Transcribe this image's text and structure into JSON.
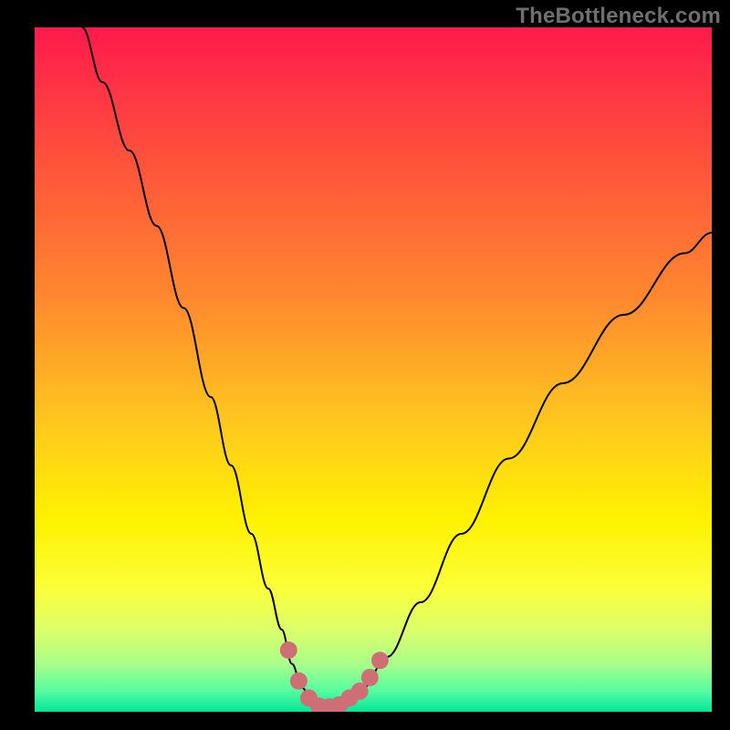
{
  "watermark": "TheBottleneck.com",
  "colors": {
    "frame": "#000000",
    "watermark_text": "#6f6f6f",
    "curve": "#000000",
    "markers": "#cf6e74",
    "gradient_stops": [
      {
        "offset": 0.0,
        "color": "#ff1a4c"
      },
      {
        "offset": 0.18,
        "color": "#ff4e3d"
      },
      {
        "offset": 0.4,
        "color": "#ff8a2e"
      },
      {
        "offset": 0.58,
        "color": "#ffc81e"
      },
      {
        "offset": 0.72,
        "color": "#fff200"
      },
      {
        "offset": 0.82,
        "color": "#fbff3a"
      },
      {
        "offset": 0.88,
        "color": "#dcff6a"
      },
      {
        "offset": 0.93,
        "color": "#a9ff8a"
      },
      {
        "offset": 0.97,
        "color": "#55fca0"
      },
      {
        "offset": 1.0,
        "color": "#00e89a"
      }
    ]
  },
  "chart_data": {
    "type": "line",
    "title": "",
    "xlabel": "",
    "ylabel": "",
    "xlim": [
      0,
      100
    ],
    "ylim": [
      0,
      100
    ],
    "series": [
      {
        "name": "bottleneck-curve",
        "x": [
          7,
          10,
          14,
          18,
          22,
          26,
          29,
          32,
          34.5,
          36.5,
          38,
          39.5,
          41,
          42.5,
          44,
          46,
          48.5,
          52,
          57,
          63,
          70,
          78,
          87,
          96,
          100
        ],
        "y": [
          100,
          92,
          82,
          71,
          59,
          46,
          36,
          26,
          18,
          12,
          7,
          3.5,
          1.5,
          0.6,
          0.6,
          1.4,
          3.5,
          8,
          16,
          26,
          37,
          48,
          58,
          67,
          70
        ]
      }
    ],
    "markers": {
      "name": "highlight-points",
      "x": [
        37.5,
        39.0,
        40.5,
        42.0,
        43.5,
        45.0,
        46.5,
        48.0,
        49.5,
        51.0
      ],
      "y": [
        9.0,
        4.5,
        2.0,
        0.8,
        0.7,
        1.0,
        2.0,
        3.0,
        5.0,
        7.5
      ]
    }
  }
}
